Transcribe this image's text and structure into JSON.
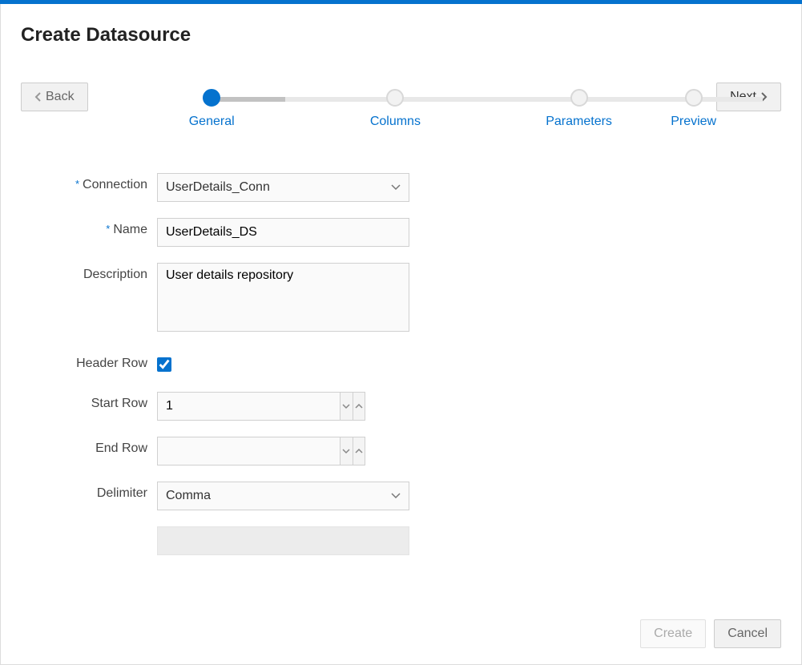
{
  "title": "Create Datasource",
  "nav": {
    "back": "Back",
    "next": "Next"
  },
  "stepper": {
    "steps": [
      {
        "label": "General",
        "active": true,
        "progress": 40
      },
      {
        "label": "Columns",
        "active": false,
        "progress": 0
      },
      {
        "label": "Parameters",
        "active": false,
        "progress": 0
      },
      {
        "label": "Preview",
        "active": false,
        "progress": 0
      }
    ]
  },
  "form": {
    "connection": {
      "label": "Connection",
      "value": "UserDetails_Conn",
      "required": true
    },
    "name": {
      "label": "Name",
      "value": "UserDetails_DS",
      "required": true
    },
    "description": {
      "label": "Description",
      "value": "User details repository"
    },
    "headerRow": {
      "label": "Header Row",
      "checked": true
    },
    "startRow": {
      "label": "Start Row",
      "value": "1"
    },
    "endRow": {
      "label": "End Row",
      "value": ""
    },
    "delimiter": {
      "label": "Delimiter",
      "value": "Comma"
    }
  },
  "footer": {
    "create": "Create",
    "cancel": "Cancel"
  }
}
